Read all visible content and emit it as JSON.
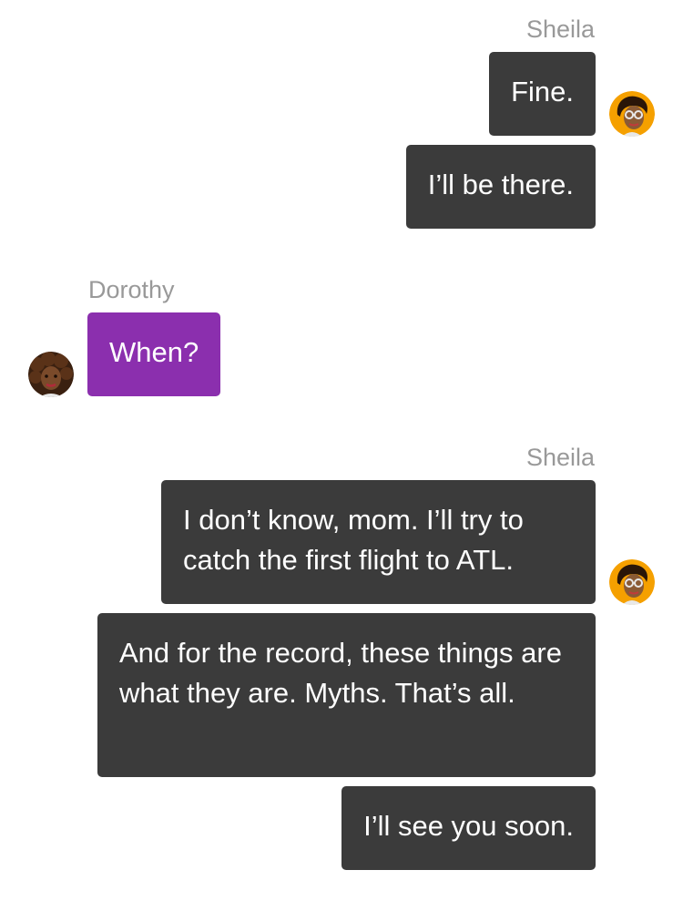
{
  "conversation": {
    "groups": [
      {
        "sender": "Sheila",
        "avatar_icon": "sheila-avatar-icon",
        "messages": [
          "Fine.",
          "I’ll be there."
        ]
      },
      {
        "sender": "Dorothy",
        "avatar_icon": "dorothy-avatar-icon",
        "messages": [
          "When?"
        ]
      },
      {
        "sender": "Sheila",
        "avatar_icon": "sheila-avatar-icon",
        "messages": [
          "I don’t know, mom. I’ll try to catch the first flight to ATL.",
          "And for the record, these things are what they are. Myths. That’s all.",
          "I’ll see you soon."
        ]
      }
    ]
  },
  "colors": {
    "outgoing_bubble": "#3b3b3b",
    "incoming_bubble": "#8b2fae",
    "sender_name": "#999999",
    "avatar_background": "#f5a000"
  }
}
